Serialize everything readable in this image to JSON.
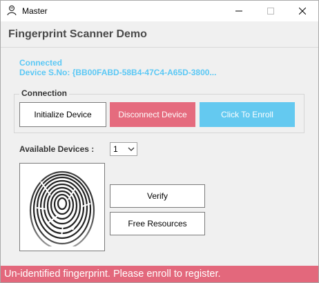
{
  "window": {
    "title": "Master"
  },
  "header": {
    "title": "Fingerprint Scanner Demo"
  },
  "status": {
    "connected": "Connected",
    "serial": "Device S.No: {BB00FABD-58B4-47C4-A65D-3800..."
  },
  "connection": {
    "label": "Connection",
    "initialize_label": "Initialize Device",
    "disconnect_label": "Disconnect Device",
    "enroll_label": "Click To Enroll"
  },
  "devices": {
    "label": "Available Devices :",
    "selected": "1"
  },
  "actions": {
    "verify_label": "Verify",
    "free_label": "Free Resources"
  },
  "statusbar": {
    "message": "Un-identified fingerprint. Please enroll to register."
  },
  "colors": {
    "accent_blue": "#64c9f0",
    "accent_red": "#e56b7e",
    "status_red": "#e3687c",
    "connected_text": "#5bc8f5"
  },
  "icons": [
    "app-icon",
    "minimize-icon",
    "maximize-icon",
    "close-icon",
    "chevron-down-icon",
    "fingerprint-image"
  ]
}
